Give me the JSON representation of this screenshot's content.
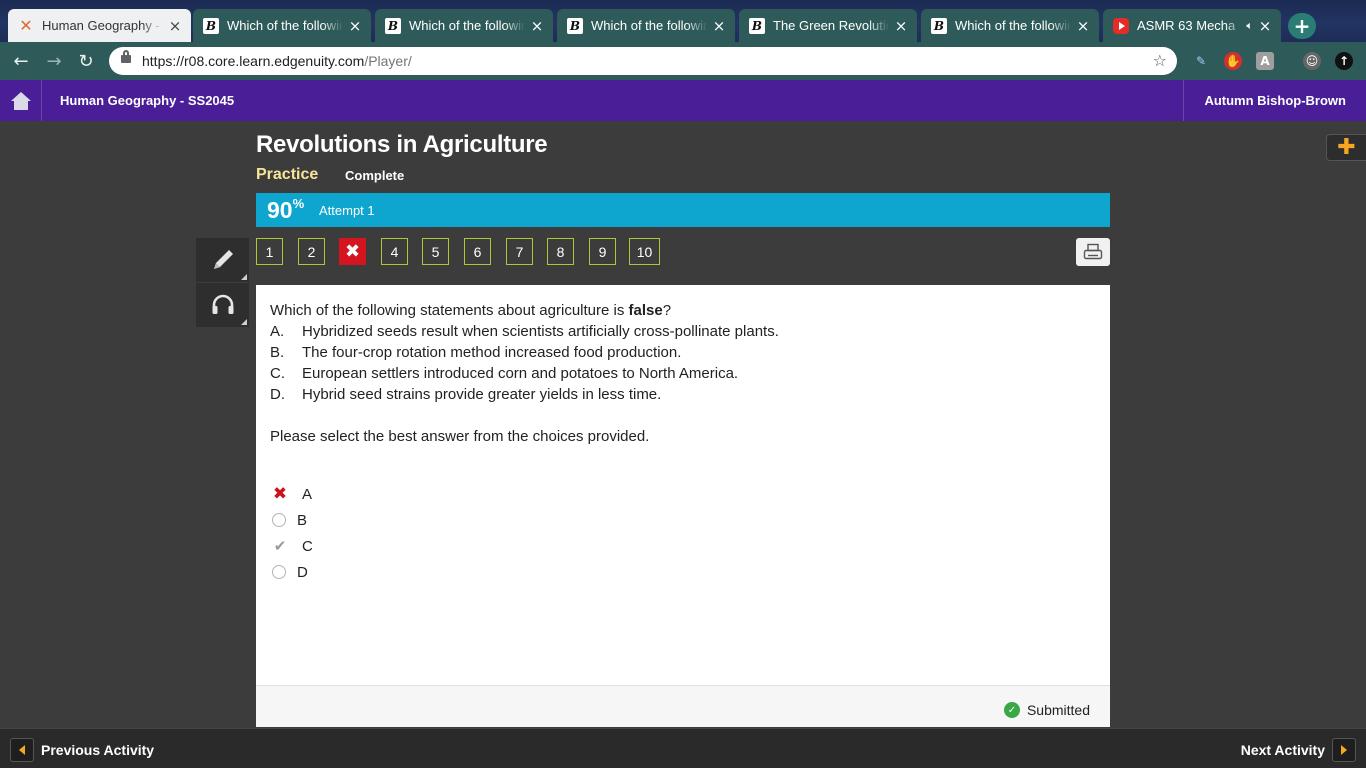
{
  "browser": {
    "tabs": [
      {
        "title": "Human Geography -",
        "favicon": "edgenuity-x-icon",
        "active": true
      },
      {
        "title": "Which of the following",
        "favicon": "brainly-b-icon",
        "active": false
      },
      {
        "title": "Which of the following",
        "favicon": "brainly-b-icon",
        "active": false
      },
      {
        "title": "Which of the following",
        "favicon": "brainly-b-icon",
        "active": false
      },
      {
        "title": "The Green Revolution",
        "favicon": "brainly-b-icon",
        "active": false
      },
      {
        "title": "Which of the following",
        "favicon": "brainly-b-icon",
        "active": false
      },
      {
        "title": "ASMR 63 Mecha",
        "favicon": "youtube-icon",
        "active": false,
        "audio": true
      }
    ],
    "url_host": "https://r08.core.learn.edgenuity.com",
    "url_path": "/Player/"
  },
  "header": {
    "course": "Human Geography - SS2045",
    "student": "Autumn Bishop-Brown"
  },
  "lesson": {
    "title": "Revolutions in Agriculture",
    "mode": "Practice",
    "state": "Complete",
    "score": "90",
    "score_unit": "%",
    "attempt": "Attempt 1"
  },
  "question_nav": {
    "buttons": [
      "1",
      "2",
      "✖",
      "4",
      "5",
      "6",
      "7",
      "8",
      "9",
      "10"
    ],
    "wrong_index": 2
  },
  "question": {
    "stem_prefix": "Which of the following statements about agriculture is ",
    "stem_emphasis": "false",
    "stem_suffix": "?",
    "choices": [
      {
        "letter": "A.",
        "text": "Hybridized seeds result when scientists artificially cross-pollinate plants."
      },
      {
        "letter": "B.",
        "text": "The four-crop rotation method increased food production."
      },
      {
        "letter": "C.",
        "text": "European settlers introduced corn and potatoes to North America."
      },
      {
        "letter": "D.",
        "text": "Hybrid seed strains provide greater yields in less time."
      }
    ],
    "instruction": "Please select the best answer from the choices provided.",
    "answers": [
      {
        "label": "A",
        "status": "incorrect-selected"
      },
      {
        "label": "B",
        "status": "unselected"
      },
      {
        "label": "C",
        "status": "correct"
      },
      {
        "label": "D",
        "status": "unselected"
      }
    ],
    "status_text": "Submitted"
  },
  "footer": {
    "prev_label": "Previous Activity",
    "next_label": "Next Activity"
  },
  "colors": {
    "header_purple": "#4a1e96",
    "score_blue": "#0ea5cf",
    "wrong_red": "#d4151f",
    "nav_green": "#a7c93a",
    "accent_orange": "#f5a623"
  }
}
